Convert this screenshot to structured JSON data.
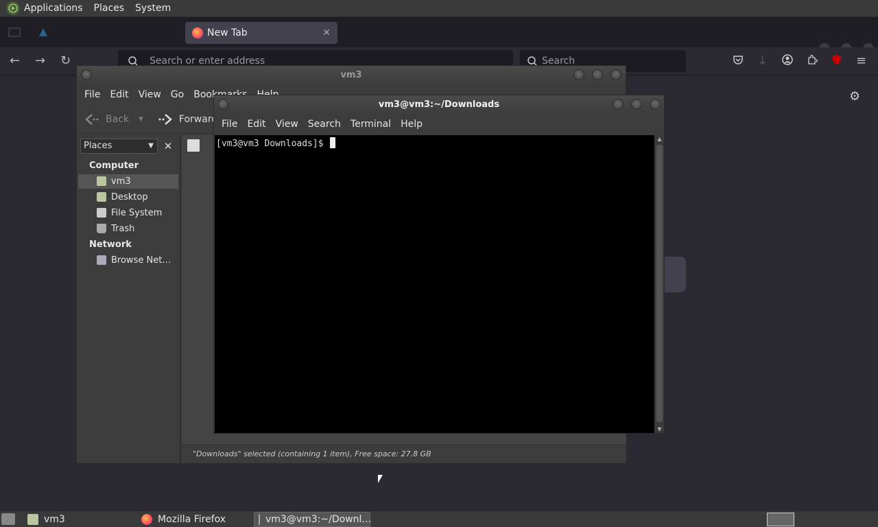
{
  "top_panel": {
    "menus": [
      "Applications",
      "Places",
      "System"
    ]
  },
  "firefox": {
    "tab_title": "New Tab",
    "address_placeholder": "Search or enter address",
    "search_placeholder": "Search",
    "taskbar_label": "Mozilla Firefox"
  },
  "file_manager": {
    "title": "vm3",
    "menu": [
      "File",
      "Edit",
      "View",
      "Go",
      "Bookmarks",
      "Help"
    ],
    "toolbar": {
      "back": "Back",
      "forward": "Forward"
    },
    "places_label": "Places",
    "sections": [
      {
        "heading": "Computer",
        "items": [
          "vm3",
          "Desktop",
          "File System",
          "Trash"
        ]
      },
      {
        "heading": "Network",
        "items": [
          "Browse Net…"
        ]
      }
    ],
    "selected_item": "vm3",
    "status": "\"Downloads\" selected (containing 1 item), Free space: 27.8 GB",
    "taskbar_label": "vm3"
  },
  "terminal": {
    "title": "vm3@vm3:~/Downloads",
    "menu": [
      "File",
      "Edit",
      "View",
      "Search",
      "Terminal",
      "Help"
    ],
    "prompt": "[vm3@vm3 Downloads]$ ",
    "taskbar_label": "vm3@vm3:~/Downl…"
  }
}
